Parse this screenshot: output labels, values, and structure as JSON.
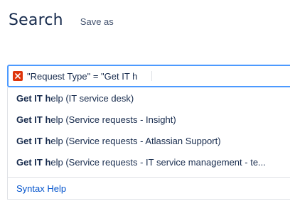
{
  "header": {
    "title": "Search",
    "save_as_label": "Save as"
  },
  "query": {
    "value": "\"Request Type\" = \"Get IT h",
    "error_icon": "error-x-icon",
    "error_color": "#de350b",
    "focus_color": "#4c9aff"
  },
  "suggestions": [
    {
      "match": "Get IT h",
      "rest": "elp (IT service desk)"
    },
    {
      "match": "Get IT h",
      "rest": "elp (Service requests - Insight)"
    },
    {
      "match": "Get IT h",
      "rest": "elp (Service requests - Atlassian Support)"
    },
    {
      "match": "Get IT h",
      "rest": "elp (Service requests - IT service management - te..."
    }
  ],
  "footer": {
    "syntax_help_label": "Syntax Help",
    "link_color": "#0052cc"
  }
}
